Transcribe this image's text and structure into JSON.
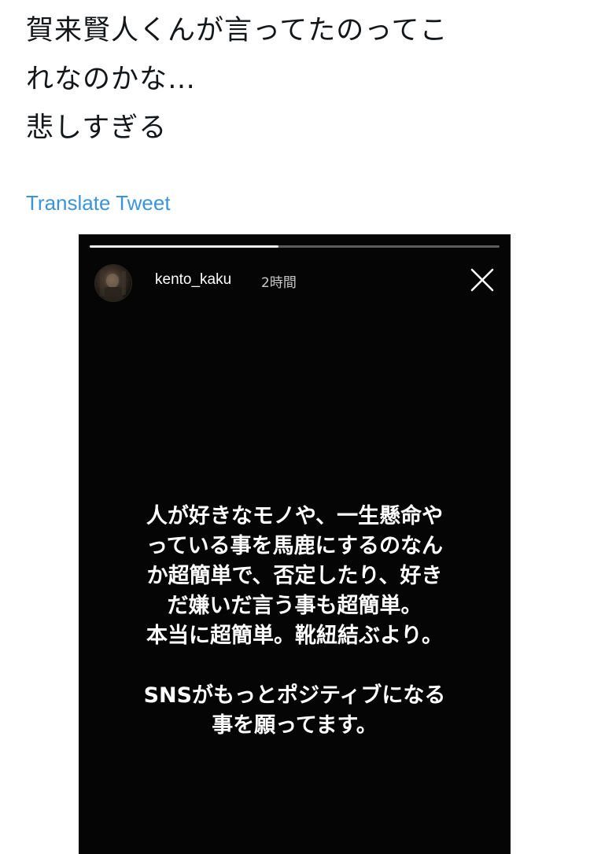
{
  "tweet": {
    "text_lines": [
      "賀来賢人くんが言ってたのってこ",
      "れなのかな…",
      "悲しすぎる"
    ],
    "translate_label": "Translate Tweet"
  },
  "story": {
    "username": "kento_kaku",
    "time_ago": "2時間",
    "progress_fraction": 0.46,
    "close_icon": "close-icon",
    "message_block1": [
      "人が好きなモノや、一生懸命や",
      "っている事を馬鹿にするのなん",
      "か超簡単で、否定したり、好き",
      "だ嫌いだ言う事も超簡単。",
      "本当に超簡単。靴紐結ぶより。"
    ],
    "message_block2": [
      "SNSがもっとポジティブになる",
      "事を願ってます。"
    ],
    "colors": {
      "story_background": "#050505",
      "link": "#3b94d9",
      "text": "#14171a"
    }
  }
}
